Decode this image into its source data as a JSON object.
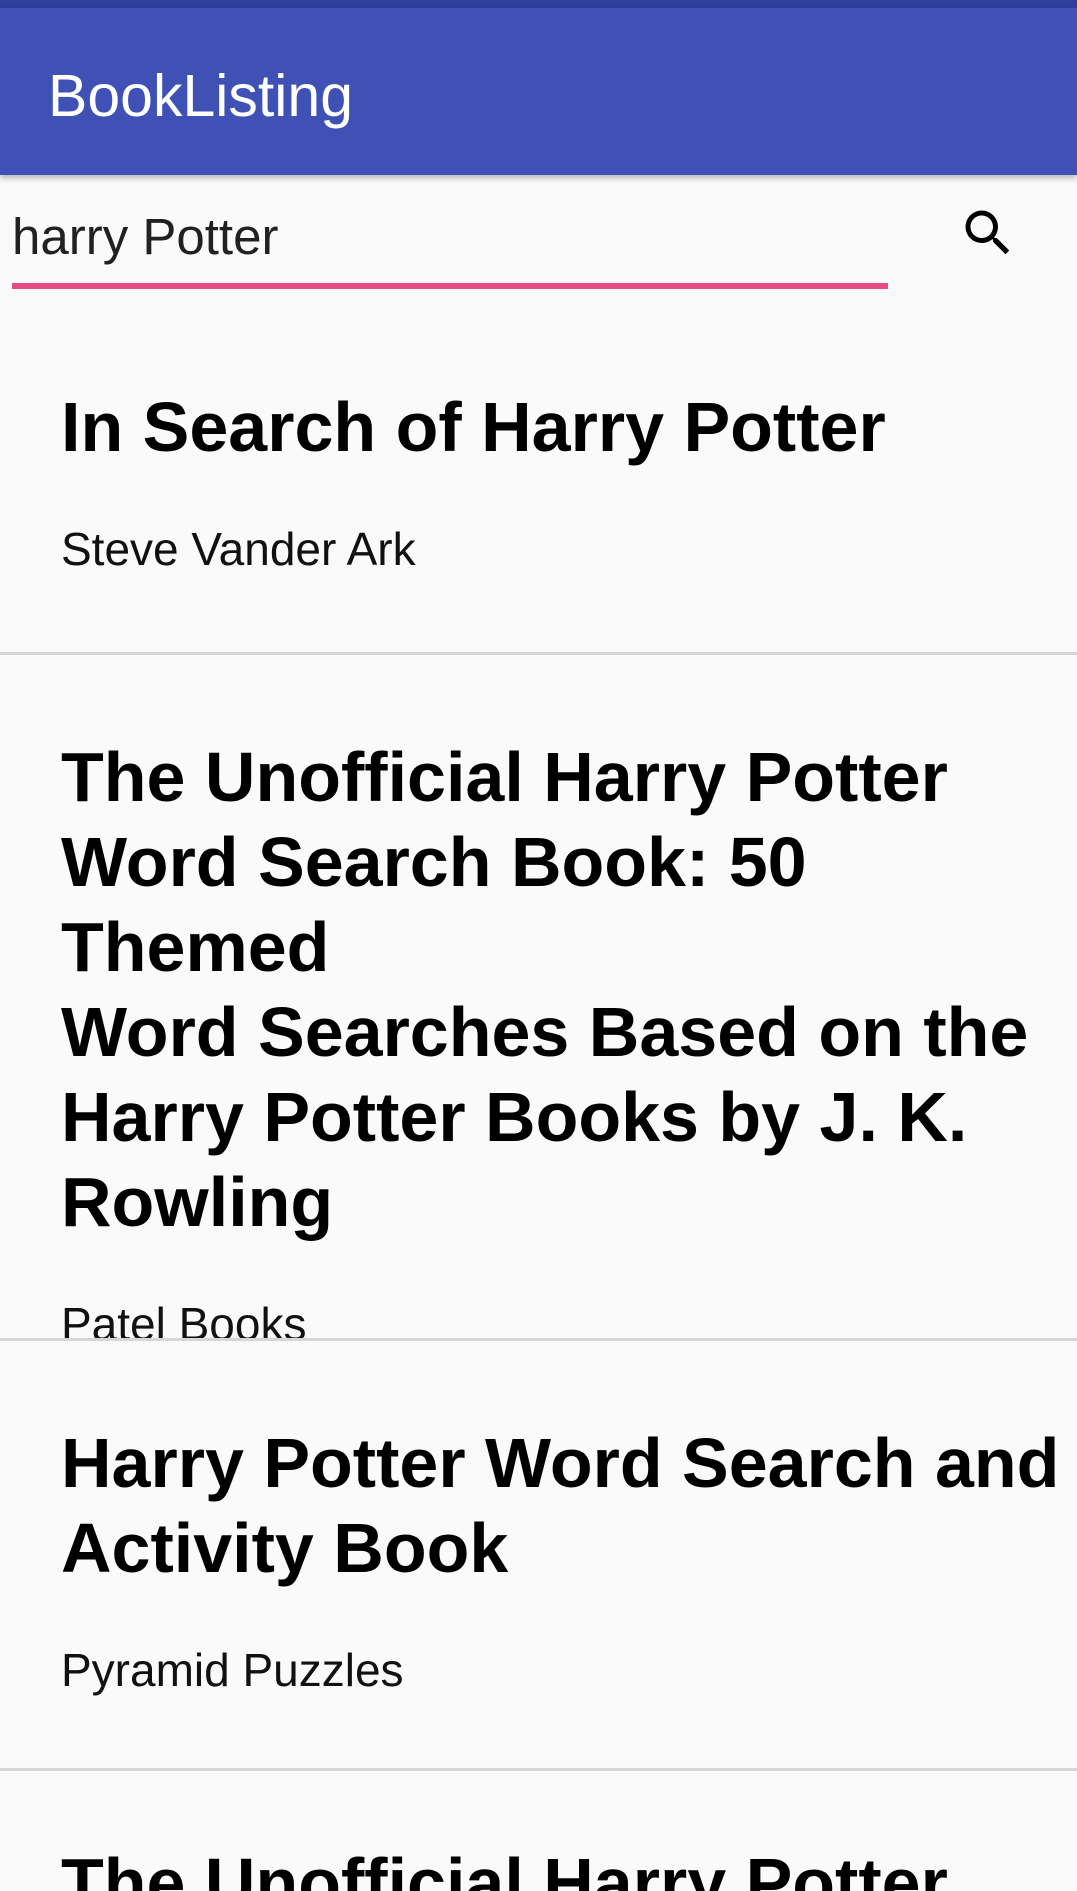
{
  "app": {
    "title": "BookListing",
    "primary_color": "#3f51b5",
    "status_bar_color": "#303f9f",
    "accent_color": "#e84a86"
  },
  "search": {
    "value": "harry Potter",
    "icon": "search-icon"
  },
  "books": [
    {
      "title": "In Search of Harry Potter",
      "author": "Steve Vander Ark"
    },
    {
      "title": "The Unofficial Harry Potter\nWord Search Book: 50 Themed\nWord Searches Based on the\nHarry Potter Books by J. K.\nRowling",
      "author": "Patel Books"
    },
    {
      "title": "Harry Potter Word Search and\nActivity Book",
      "author": "Pyramid Puzzles"
    },
    {
      "title": "The Unofficial Harry Potter",
      "author": ""
    }
  ]
}
